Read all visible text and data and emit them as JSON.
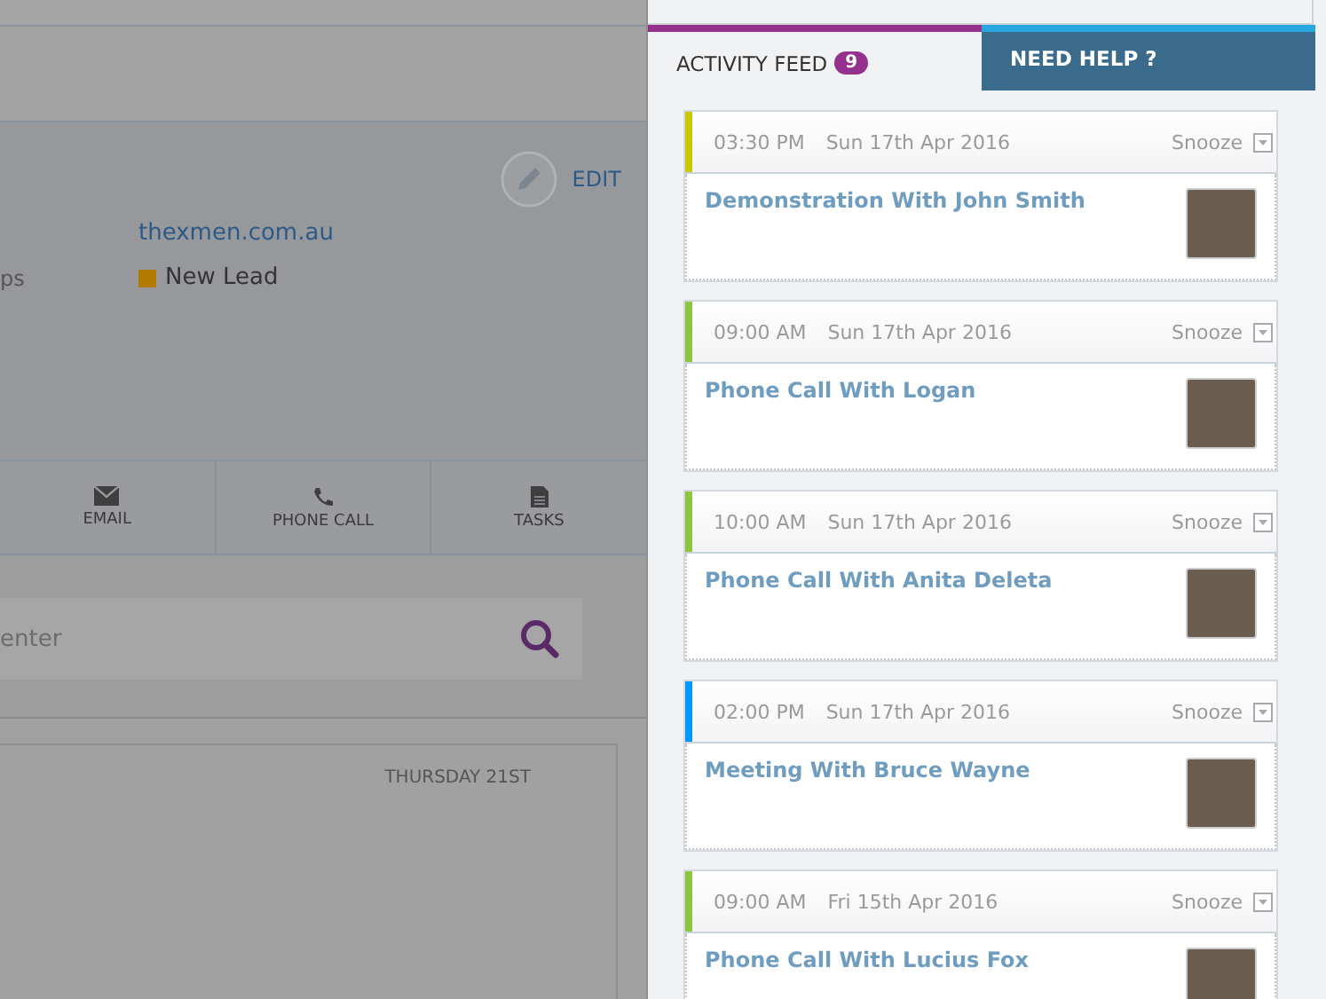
{
  "contact": {
    "edit_label": "EDIT",
    "website": "thexmen.com.au",
    "field_label": "ps",
    "status": "New Lead"
  },
  "actions": [
    {
      "label": "EMAIL",
      "kind": "email"
    },
    {
      "label": "PHONE CALL",
      "kind": "phone"
    },
    {
      "label": "TASKS",
      "kind": "tasks"
    }
  ],
  "search": {
    "placeholder": "enter"
  },
  "calendar": {
    "day_heading": "THURSDAY 21ST"
  },
  "tabs": [
    {
      "label": "ACTIVITY FEED",
      "badge": "9",
      "selected": true
    },
    {
      "label": "NEED HELP ?",
      "selected": false
    }
  ],
  "feed": [
    {
      "time": "03:30 PM",
      "date": "Sun 17th Apr 2016",
      "snooze": "Snooze",
      "title": "Demonstration With John Smith",
      "color": "#c8c800"
    },
    {
      "time": "09:00 AM",
      "date": "Sun 17th Apr 2016",
      "snooze": "Snooze",
      "title": "Phone Call With Logan",
      "color": "#8cc63f"
    },
    {
      "time": "10:00 AM",
      "date": "Sun 17th Apr 2016",
      "snooze": "Snooze",
      "title": "Phone Call With Anita Deleta",
      "color": "#8cc63f"
    },
    {
      "time": "02:00 PM",
      "date": "Sun 17th Apr 2016",
      "snooze": "Snooze",
      "title": "Meeting With Bruce Wayne",
      "color": "#0096ff"
    },
    {
      "time": "09:00 AM",
      "date": "Fri 15th Apr 2016",
      "snooze": "Snooze",
      "title": "Phone Call With Lucius Fox",
      "color": "#8cc63f"
    }
  ]
}
